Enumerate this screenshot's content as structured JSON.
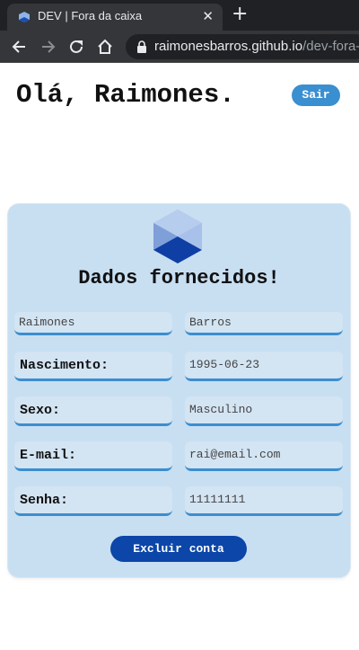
{
  "browser": {
    "tab_title": "DEV | Fora da caixa",
    "close_glyph": "✕",
    "new_tab_glyph": "+",
    "url_host": "raimonesbarros.github.io",
    "url_path": "/dev-fora-d"
  },
  "header": {
    "greeting": "Olá, Raimones.",
    "logout_label": "Sair"
  },
  "card": {
    "title": "Dados fornecidos!",
    "first_name": "Raimones",
    "last_name": "Barros",
    "rows": [
      {
        "label": "Nascimento:",
        "value": "1995-06-23"
      },
      {
        "label": "Sexo:",
        "value": "Masculino"
      },
      {
        "label": "E-mail:",
        "value": "rai@email.com"
      },
      {
        "label": "Senha:",
        "value": "11111111"
      }
    ],
    "delete_label": "Excluir conta"
  },
  "colors": {
    "accent": "#3b8ecf",
    "card_bg": "#c8dff2",
    "delete_button": "#0b46a8"
  },
  "icons": {
    "favicon": "dev-logo-icon",
    "back": "arrow-left-icon",
    "forward": "arrow-right-icon",
    "reload": "reload-icon",
    "home": "home-icon",
    "lock": "lock-icon",
    "card_logo": "cube-logo-icon"
  }
}
